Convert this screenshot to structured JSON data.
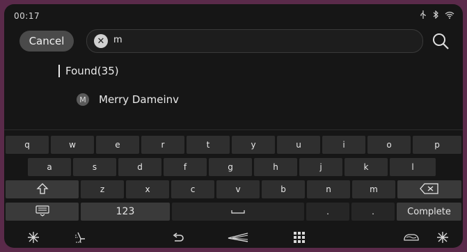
{
  "status": {
    "time": "00:17",
    "icons": [
      "usb-icon",
      "bluetooth-icon",
      "wifi-icon"
    ]
  },
  "header": {
    "cancel_label": "Cancel",
    "search_value": "m",
    "search_icon": "search-icon",
    "clear_icon": "clear-icon"
  },
  "results": {
    "found_label": "Found(35)",
    "items": [
      {
        "badge": "M",
        "name": "Merry Dameinv"
      }
    ]
  },
  "keyboard": {
    "row1": [
      "q",
      "w",
      "e",
      "r",
      "t",
      "y",
      "u",
      "i",
      "o",
      "p"
    ],
    "row2": [
      "a",
      "s",
      "d",
      "f",
      "g",
      "h",
      "j",
      "k",
      "l"
    ],
    "row3": [
      "z",
      "x",
      "c",
      "v",
      "b",
      "n",
      "m"
    ],
    "numbers_label": "123",
    "dot1": ".",
    "dot2": ".",
    "complete_label": "Complete"
  },
  "bottom_bar": {
    "icons": [
      "fan-icon",
      "seat-airflow-icon",
      "back-icon",
      "home-icon",
      "apps-icon",
      "car-air-icon",
      "fan-icon"
    ]
  }
}
